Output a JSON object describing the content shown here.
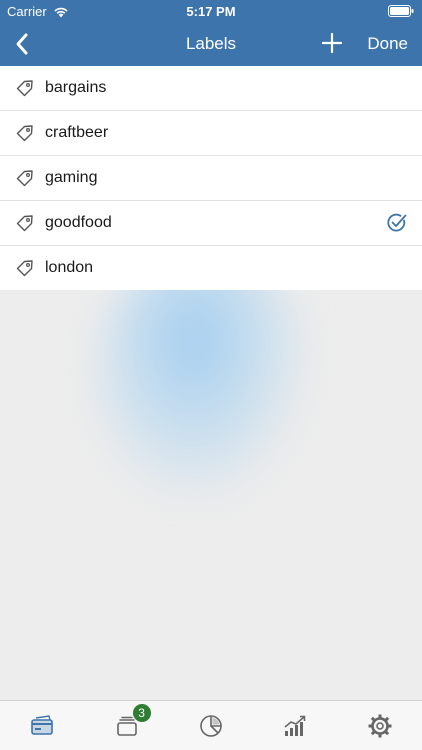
{
  "status_bar": {
    "carrier": "Carrier",
    "time": "5:17 PM"
  },
  "nav": {
    "title": "Labels",
    "done_label": "Done",
    "back_icon": "chevron-left-icon",
    "add_icon": "plus-icon"
  },
  "labels": [
    {
      "name": "bargains",
      "selected": false
    },
    {
      "name": "craftbeer",
      "selected": false
    },
    {
      "name": "gaming",
      "selected": false
    },
    {
      "name": "goodfood",
      "selected": true
    },
    {
      "name": "london",
      "selected": false
    }
  ],
  "tabs": [
    {
      "name": "cards",
      "icon": "card-icon",
      "active": true
    },
    {
      "name": "wallets",
      "icon": "stack-icon",
      "badge": "3"
    },
    {
      "name": "reports",
      "icon": "pie-chart-icon"
    },
    {
      "name": "trends",
      "icon": "trend-chart-icon"
    },
    {
      "name": "settings",
      "icon": "gear-icon"
    }
  ],
  "colors": {
    "accent": "#3c74ab",
    "badge": "#2e7d32",
    "tab_active": "#3c74ab",
    "tab_inactive": "#666666"
  }
}
